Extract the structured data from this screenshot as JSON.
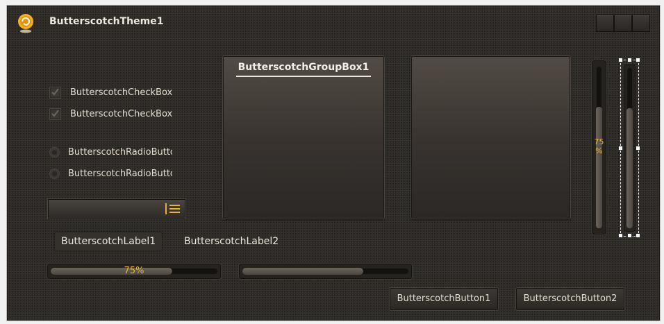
{
  "window": {
    "title": "ButterscotchTheme1",
    "logo_icon": "butterscotch-logo-icon",
    "controls": [
      "minimize-button",
      "maximize-button",
      "close-button"
    ]
  },
  "checkboxes": [
    {
      "label": "ButterscotchCheckBox",
      "checked": true
    },
    {
      "label": "ButterscotchCheckBox",
      "checked": true
    }
  ],
  "radios": [
    {
      "label": "ButterscotchRadioButto",
      "selected": false
    },
    {
      "label": "ButterscotchRadioButto",
      "selected": false
    }
  ],
  "combobox": {
    "icon": "list-icon",
    "value": ""
  },
  "labels": [
    "ButterscotchLabel1",
    "ButterscotchLabel2"
  ],
  "groupboxes": [
    {
      "title": "ButterscotchGroupBox1"
    },
    {
      "title": ""
    }
  ],
  "progress_bars": [
    {
      "value": 0.75,
      "text": "75%"
    },
    {
      "value": 0.75,
      "text": ""
    }
  ],
  "vertical_progress": {
    "value": 0.75,
    "text_top": "75",
    "text_bottom": "%"
  },
  "vertical_trackbar": {
    "value": 0.75
  },
  "buttons": [
    "ButterscotchButton1",
    "ButterscotchButton2"
  ],
  "colors": {
    "accent": "#e8b23a",
    "background": "#2e2b27",
    "text": "#e4ddd0"
  }
}
